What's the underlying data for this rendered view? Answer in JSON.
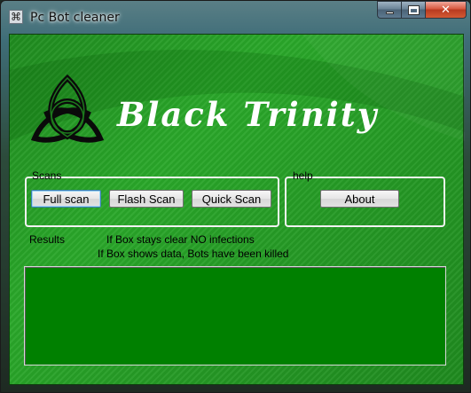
{
  "window": {
    "title": "Pc Bot cleaner",
    "icon": "app-icon"
  },
  "caption": {
    "minimize_icon": "minimize-icon",
    "maximize_icon": "maximize-icon",
    "close_glyph": "✕"
  },
  "brand": {
    "title": "Black Trinity",
    "logo_icon": "triquetra-icon"
  },
  "scans": {
    "legend": "Scans",
    "full_scan": "Full scan",
    "flash_scan": "Flash Scan",
    "quick_scan": "Quick Scan"
  },
  "help": {
    "legend": "help",
    "about": "About"
  },
  "results": {
    "label": "Results",
    "info_line_1": "If Box stays clear NO infections",
    "info_line_2": "If Box shows data, Bots have been killed",
    "box_content": ""
  },
  "colors": {
    "background_green": "#2aa82a",
    "results_box": "#008000",
    "brand_text": "#ffffff"
  }
}
